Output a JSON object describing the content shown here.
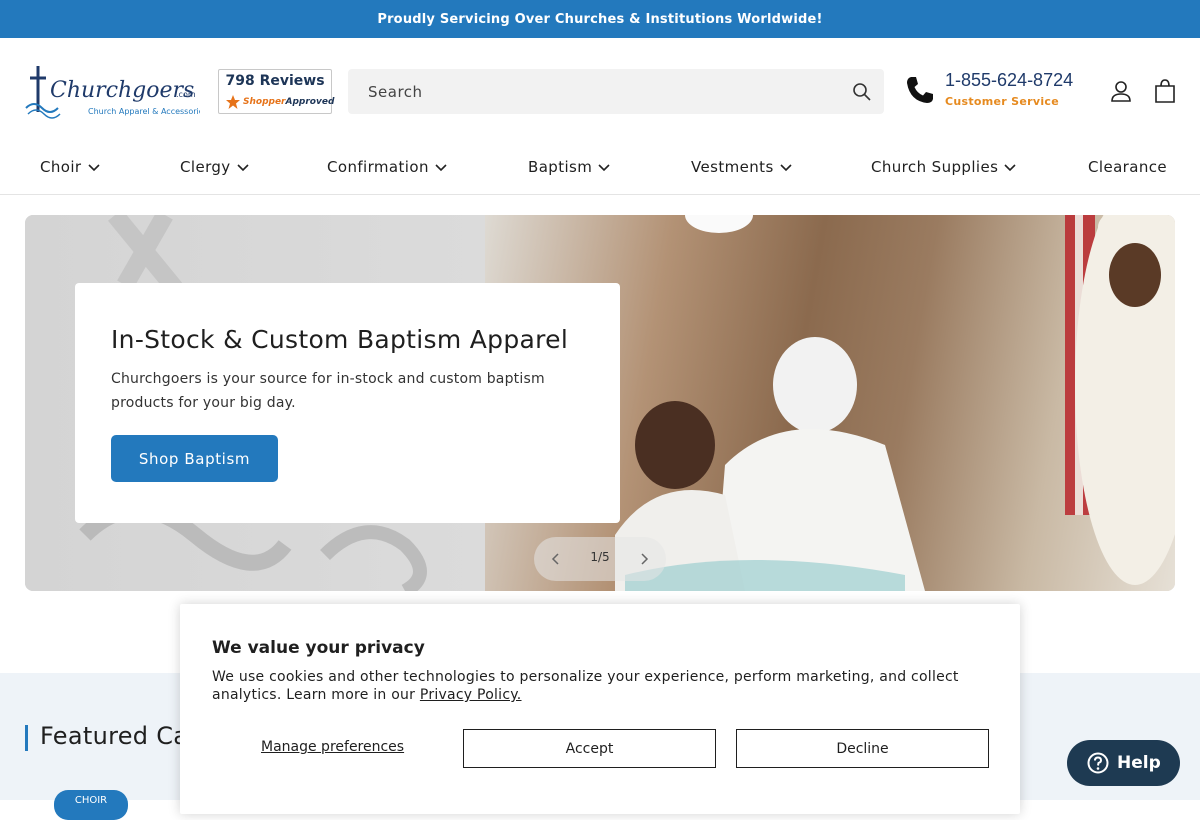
{
  "announcement": "Proudly Servicing Over Churches & Institutions Worldwide!",
  "logo": {
    "name": "Churchgoers",
    "suffix": ".com",
    "tagline": "Church Apparel & Accessories"
  },
  "reviews": {
    "count": "798 Reviews",
    "brand_a": "Shopper",
    "brand_b": "Approved"
  },
  "search": {
    "placeholder": "Search"
  },
  "phone": {
    "number": "1-855-624-8724",
    "label": "Customer Service"
  },
  "nav": [
    "Choir",
    "Clergy",
    "Confirmation",
    "Baptism",
    "Vestments",
    "Church Supplies",
    "Clearance"
  ],
  "hero": {
    "title": "In-Stock & Custom Baptism Apparel",
    "description": "Churchgoers is your source for in-stock and custom baptism products for your big day.",
    "button": "Shop Baptism"
  },
  "slider": {
    "counter": "1/5"
  },
  "featured": {
    "title": "Featured Ca",
    "chip": "CHOIR"
  },
  "privacy": {
    "title": "We value your privacy",
    "text": "We use cookies and other technologies to personalize your experience, perform marketing, and collect analytics. Learn more in our ",
    "link": "Privacy Policy.",
    "manage": "Manage preferences",
    "accept": "Accept",
    "decline": "Decline"
  },
  "help": {
    "label": "Help"
  },
  "colors": {
    "brand_blue": "#2379bd",
    "navy": "#1f3a6a",
    "orange": "#e68a1f",
    "help_bg": "#1e3a52"
  }
}
